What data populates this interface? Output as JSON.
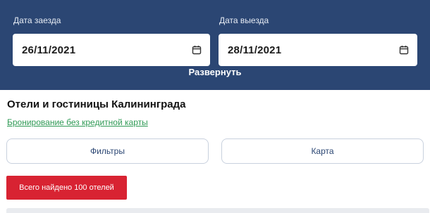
{
  "search": {
    "checkin_label": "Дата заезда",
    "checkin_value": "26/11/2021",
    "checkout_label": "Дата выезда",
    "checkout_value": "28/11/2021",
    "expand_label": "Развернуть"
  },
  "page": {
    "title": "Отели и гостиницы Калининграда",
    "nocard_link": "Бронирование без кредитной карты"
  },
  "actions": {
    "filters_label": "Фильтры",
    "map_label": "Карта"
  },
  "results": {
    "count_text": "Всего найдено 100 отелей"
  },
  "icons": {
    "date_picker": "calendar-icon"
  },
  "colors": {
    "header_bg": "#2b4673",
    "link_green": "#2f9a55",
    "badge_red": "#d82332"
  }
}
